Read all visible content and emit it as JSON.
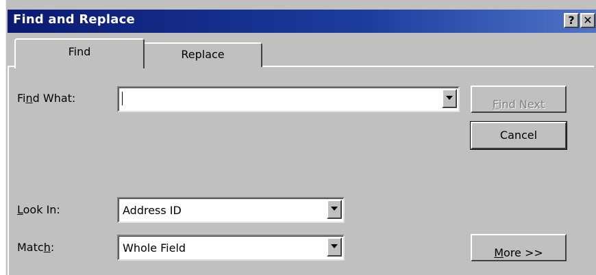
{
  "window": {
    "title": "Find and Replace",
    "help_glyph": "?",
    "close_glyph": "✕"
  },
  "tabs": [
    {
      "label": "Find",
      "selected": true
    },
    {
      "label": "Replace",
      "selected": false
    }
  ],
  "find_what": {
    "label_prefix": "Fi",
    "label_mnemonic": "n",
    "label_suffix": "d What:",
    "value": ""
  },
  "look_in": {
    "label_mnemonic": "L",
    "label_suffix": "ook In:",
    "value": "Address ID"
  },
  "match": {
    "label_prefix": "Matc",
    "label_mnemonic": "h",
    "label_suffix": ":",
    "value": "Whole Field"
  },
  "buttons": {
    "find_next_mnemonic": "F",
    "find_next_suffix": "ind Next",
    "cancel": "Cancel",
    "more_mnemonic": "M",
    "more_suffix": "ore >>"
  },
  "icons": {
    "dropdown": "chevron-down-icon",
    "help": "help-icon",
    "close": "close-icon"
  },
  "colors": {
    "title_bar_start": "#0a1a72",
    "title_bar_end": "#4f74c8",
    "dialog_face": "#c0c0c0"
  }
}
